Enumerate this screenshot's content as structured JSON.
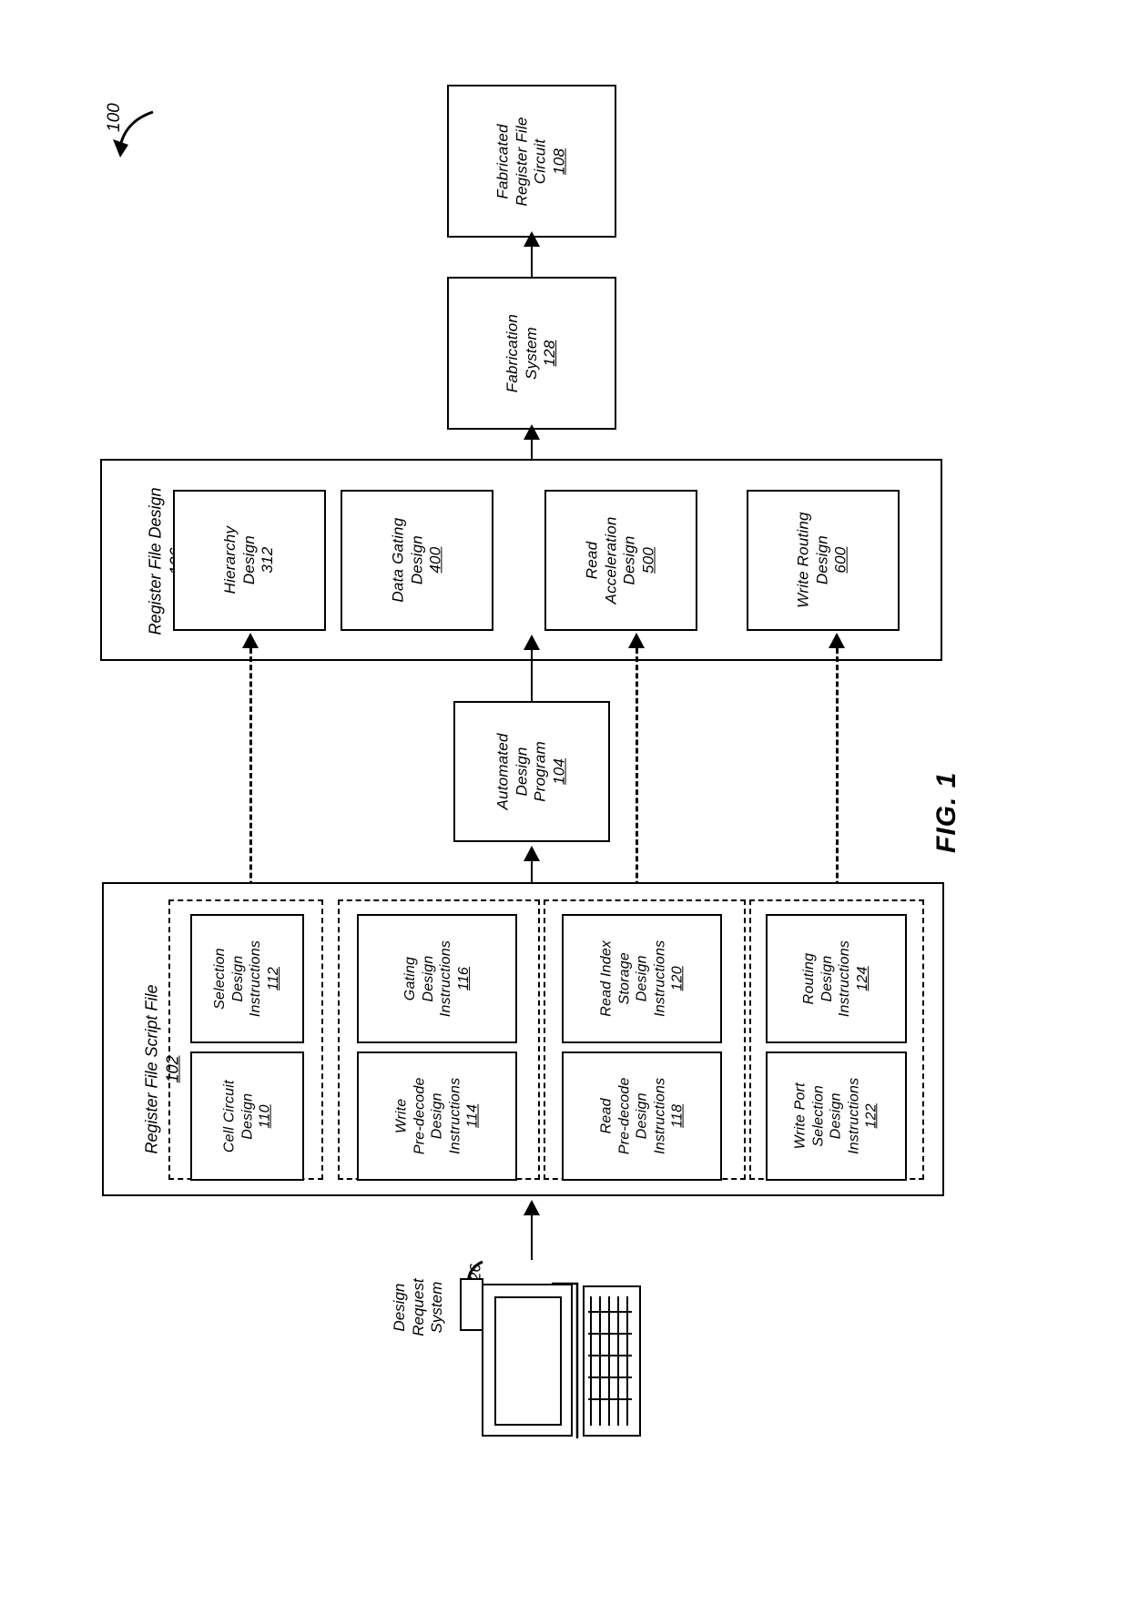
{
  "figure": {
    "caption": "FIG. 1",
    "system_ref": "100"
  },
  "fabricated_circuit": {
    "line1": "Fabricated",
    "line2": "Register File",
    "line3": "Circuit",
    "ref": "108"
  },
  "fabrication_system": {
    "line1": "Fabrication",
    "line2": "System",
    "ref": "128"
  },
  "register_file_design": {
    "title_line1": "Register File Design",
    "ref": "106",
    "blocks": [
      {
        "line1": "Hierarchy",
        "line2": "Design",
        "ref": "312",
        "underline": false
      },
      {
        "line1": "Data Gating",
        "line2": "Design",
        "ref": "400",
        "underline": true
      },
      {
        "line1": "Read",
        "line2": "Acceleration",
        "line3": "Design",
        "ref": "500",
        "underline": true
      },
      {
        "line1": "Write Routing",
        "line2": "Design",
        "ref": "600",
        "underline": true
      }
    ]
  },
  "automated_design_program": {
    "line1": "Automated",
    "line2": "Design",
    "line3": "Program",
    "ref": "104"
  },
  "register_file_script_file": {
    "title_line1": "Register File Script File",
    "ref": "102",
    "groups": [
      {
        "name": "cell-selection-group",
        "items": [
          {
            "line1": "Cell Circuit",
            "line2": "Design",
            "ref": "110"
          },
          {
            "line1": "Selection",
            "line2": "Design",
            "line3": "Instructions",
            "ref": "112"
          }
        ]
      },
      {
        "name": "write-gating-group",
        "items": [
          {
            "line1": "Write",
            "line2": "Pre-decode",
            "line3": "Design",
            "line4": "Instructions",
            "ref": "114"
          },
          {
            "line1": "Gating",
            "line2": "Design",
            "line3": "Instructions",
            "ref": "116"
          }
        ]
      },
      {
        "name": "read-group",
        "items": [
          {
            "line1": "Read",
            "line2": "Pre-decode",
            "line3": "Design",
            "line4": "Instructions",
            "ref": "118"
          },
          {
            "line1": "Read Index",
            "line2": "Storage",
            "line3": "Design",
            "line4": "Instructions",
            "ref": "120"
          }
        ]
      },
      {
        "name": "write-port-routing-group",
        "items": [
          {
            "line1": "Write Port",
            "line2": "Selection",
            "line3": "Design",
            "line4": "Instructions",
            "ref": "122"
          },
          {
            "line1": "Routing",
            "line2": "Design",
            "line3": "Instructions",
            "ref": "124"
          }
        ]
      }
    ]
  },
  "design_request_system": {
    "line1": "Design",
    "line2": "Request",
    "line3": "System",
    "ref": "126"
  }
}
